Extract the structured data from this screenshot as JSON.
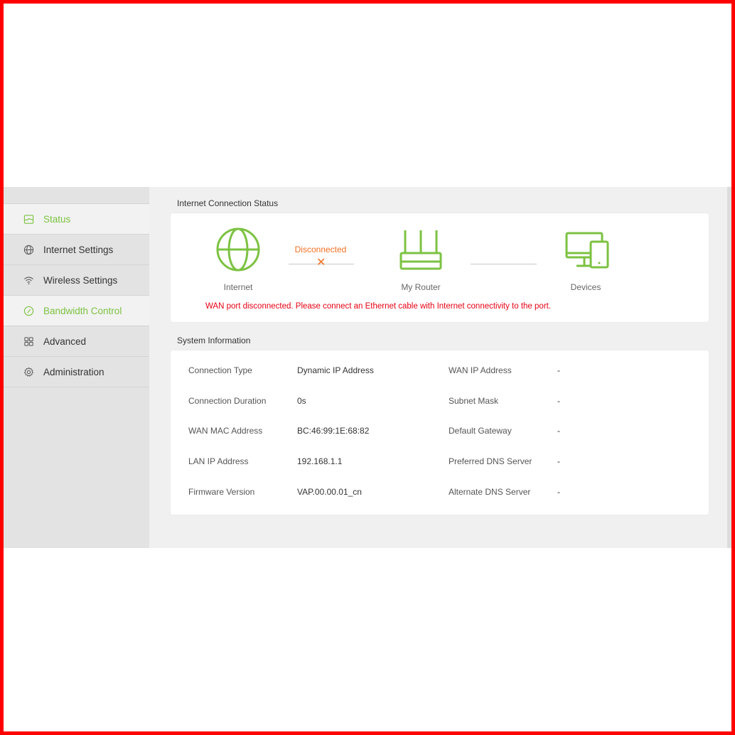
{
  "sidebar": {
    "items": [
      {
        "label": "Status",
        "icon": "status-icon",
        "active": true
      },
      {
        "label": "Internet Settings",
        "icon": "globe-icon",
        "active": false
      },
      {
        "label": "Wireless Settings",
        "icon": "wifi-icon",
        "active": false
      },
      {
        "label": "Bandwidth Control",
        "icon": "speedometer-icon",
        "active": true
      },
      {
        "label": "Advanced",
        "icon": "grid-icon",
        "active": false
      },
      {
        "label": "Administration",
        "icon": "gear-icon",
        "active": false
      }
    ]
  },
  "connection": {
    "title": "Internet Connection Status",
    "internet_label": "Internet",
    "router_label": "My Router",
    "devices_label": "Devices",
    "status_text": "Disconnected",
    "warning": "WAN port disconnected. Please connect an Ethernet cable with Internet connectivity to the port."
  },
  "system": {
    "title": "System Information",
    "left": [
      {
        "label": "Connection Type",
        "value": "Dynamic IP Address"
      },
      {
        "label": "Connection Duration",
        "value": "0s"
      },
      {
        "label": "WAN MAC Address",
        "value": "BC:46:99:1E:68:82"
      },
      {
        "label": "LAN IP Address",
        "value": "192.168.1.1"
      },
      {
        "label": "Firmware Version",
        "value": "VAP.00.00.01_cn"
      }
    ],
    "right": [
      {
        "label": "WAN IP Address",
        "value": "-"
      },
      {
        "label": "Subnet Mask",
        "value": "-"
      },
      {
        "label": "Default Gateway",
        "value": "-"
      },
      {
        "label": "Preferred DNS Server",
        "value": "-"
      },
      {
        "label": "Alternate DNS Server",
        "value": "-"
      }
    ]
  },
  "colors": {
    "accent": "#7cc242",
    "error": "#e60012",
    "warning_orange": "#f36f21",
    "border": "#ff0000"
  }
}
